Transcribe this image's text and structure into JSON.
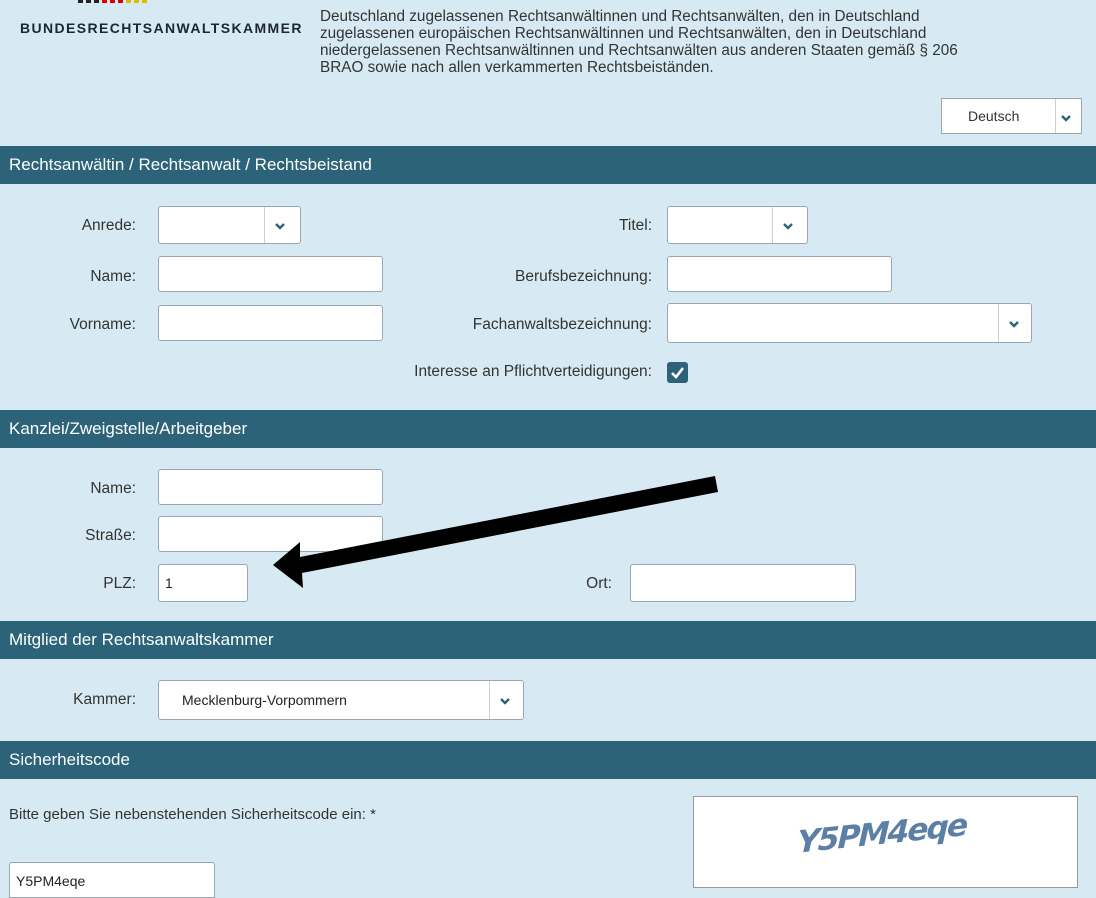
{
  "header": {
    "logo_text": "BUNDESRECHTSANWALTSKAMMER",
    "intro_lines": [
      "Deutschland zugelassenen Rechtsanwältinnen und Rechtsanwälten, den in Deutschland",
      "zugelassenen europäischen Rechtsanwältinnen und Rechtsanwälten, den in Deutschland",
      "niedergelassenen Rechtsanwältinnen und Rechtsanwälten aus anderen Staaten gemäß § 206",
      "BRAO sowie nach allen verkammerten Rechtsbeiständen."
    ],
    "language": "Deutsch"
  },
  "sections": {
    "person": "Rechtsanwältin / Rechtsanwalt / Rechtsbeistand",
    "office": "Kanzlei/Zweigstelle/Arbeitgeber",
    "chamber": "Mitglied der Rechtsanwaltskammer",
    "security": "Sicherheitscode"
  },
  "person": {
    "anrede_label": "Anrede:",
    "anrede_value": "",
    "titel_label": "Titel:",
    "titel_value": "",
    "name_label": "Name:",
    "name_value": "",
    "berufsbezeichnung_label": "Berufsbezeichnung:",
    "berufsbezeichnung_value": "",
    "vorname_label": "Vorname:",
    "vorname_value": "",
    "fachanwalt_label": "Fachanwaltsbezeichnung:",
    "fachanwalt_value": "",
    "pflicht_label": "Interesse an Pflichtverteidigungen:",
    "pflicht_checked": true
  },
  "office": {
    "name_label": "Name:",
    "name_value": "",
    "strasse_label": "Straße:",
    "strasse_value": "",
    "plz_label": "PLZ:",
    "plz_value": "1",
    "ort_label": "Ort:",
    "ort_value": ""
  },
  "chamber": {
    "kammer_label": "Kammer:",
    "kammer_value": "Mecklenburg-Vorpommern"
  },
  "security": {
    "prompt": "Bitte geben Sie nebenstehenden Sicherheitscode ein: *",
    "input_value": "Y5PM4eqe",
    "captcha_image_text": "Y5PM4eqe"
  },
  "colors": {
    "background": "#d7eaf3",
    "section_bar": "#2c6379",
    "arrow": "#000000"
  },
  "icons": {
    "dropdown": "chevron-down-icon",
    "checkbox": "checkmark-icon",
    "annotation": "arrow-icon"
  }
}
